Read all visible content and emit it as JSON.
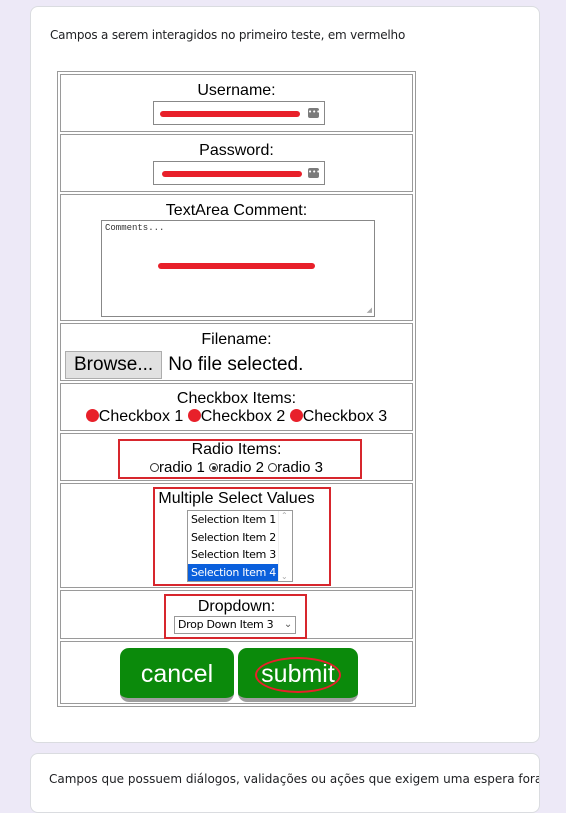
{
  "caption": "Campos a serem interagidos no primeiro teste, em vermelho",
  "caption_next": "Campos que possuem diálogos, validações ou ações que exigem uma espera foram selecionados",
  "accent_red": "#e8202a",
  "button_green": "#0b8a0b",
  "form": {
    "username_label": "Username:",
    "password_label": "Password:",
    "textarea_label": "TextArea Comment:",
    "textarea_placeholder": "Comments...",
    "filename_label": "Filename:",
    "browse_label": "Browse...",
    "no_file_text": "No file selected.",
    "checkbox_label": "Checkbox Items:",
    "checkboxes": [
      "Checkbox 1",
      "Checkbox 2",
      "Checkbox 3"
    ],
    "radio_label": "Radio Items:",
    "radios": [
      "radio 1",
      "radio 2",
      "radio 3"
    ],
    "radio_selected": "radio 2",
    "multiselect_label": "Multiple Select Values",
    "multiselect_options": [
      "Selection Item 1",
      "Selection Item 2",
      "Selection Item 3",
      "Selection Item 4"
    ],
    "multiselect_selected": "Selection Item 4",
    "dropdown_label": "Dropdown:",
    "dropdown_value": "Drop Down Item 3",
    "cancel_label": "cancel",
    "submit_label": "submit"
  },
  "icons": {
    "password_manager": "key-icon",
    "select_chevron": "chevron-down-icon",
    "scroll_up": "chevron-up-icon",
    "scroll_down": "chevron-down-icon"
  }
}
